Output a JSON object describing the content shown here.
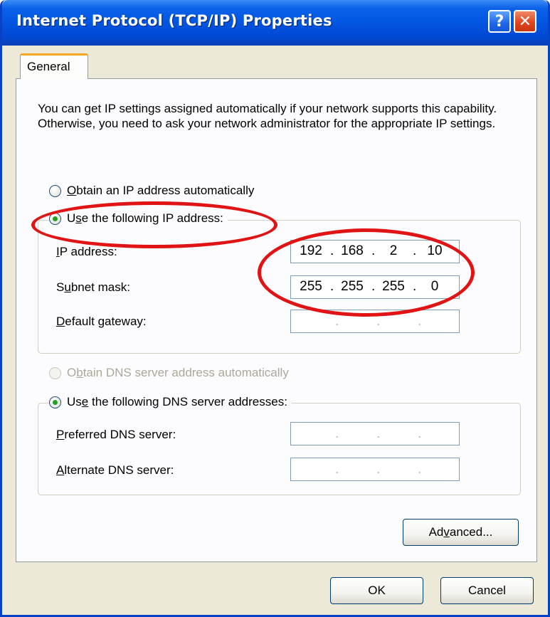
{
  "window": {
    "title": "Internet Protocol (TCP/IP) Properties",
    "help_glyph": "?",
    "close_glyph": "✕"
  },
  "tabs": [
    {
      "label": "General",
      "active": true
    }
  ],
  "intro_text": "You can get IP settings assigned automatically if your network supports this capability. Otherwise, you need to ask your network administrator for the appropriate IP settings.",
  "ip_mode": {
    "auto": {
      "accel": "O",
      "rest": "btain an IP address automatically",
      "checked": false
    },
    "manual": {
      "pre": "U",
      "accel": "s",
      "rest": "e the following IP address:",
      "checked": true
    }
  },
  "ip_fields": {
    "ip_address": {
      "accel": "I",
      "rest": "P address:",
      "octets": [
        "192",
        "168",
        "2",
        "10"
      ]
    },
    "subnet_mask": {
      "pre": "S",
      "accel": "u",
      "rest": "bnet mask:",
      "octets": [
        "255",
        "255",
        "255",
        "0"
      ]
    },
    "default_gateway": {
      "accel": "D",
      "rest": "efault gateway:",
      "octets": [
        "",
        "",
        "",
        ""
      ]
    }
  },
  "dns_mode": {
    "auto": {
      "pre": "O",
      "accel": "b",
      "rest": "tain DNS server address automatically",
      "checked": false,
      "disabled": true
    },
    "manual": {
      "pre": "Us",
      "accel": "e",
      "rest": " the following DNS server addresses:",
      "checked": true
    }
  },
  "dns_fields": {
    "preferred": {
      "accel": "P",
      "rest": "referred DNS server:",
      "octets": [
        "",
        "",
        "",
        ""
      ]
    },
    "alternate": {
      "accel": "A",
      "rest": "lternate DNS server:",
      "octets": [
        "",
        "",
        "",
        ""
      ]
    }
  },
  "buttons": {
    "advanced": {
      "pre": "Ad",
      "accel": "v",
      "rest": "anced..."
    },
    "ok": "OK",
    "cancel": "Cancel"
  },
  "colors": {
    "titlebar": "#0255e0",
    "annotation": "#e01414",
    "radio_dot": "#21a121"
  }
}
